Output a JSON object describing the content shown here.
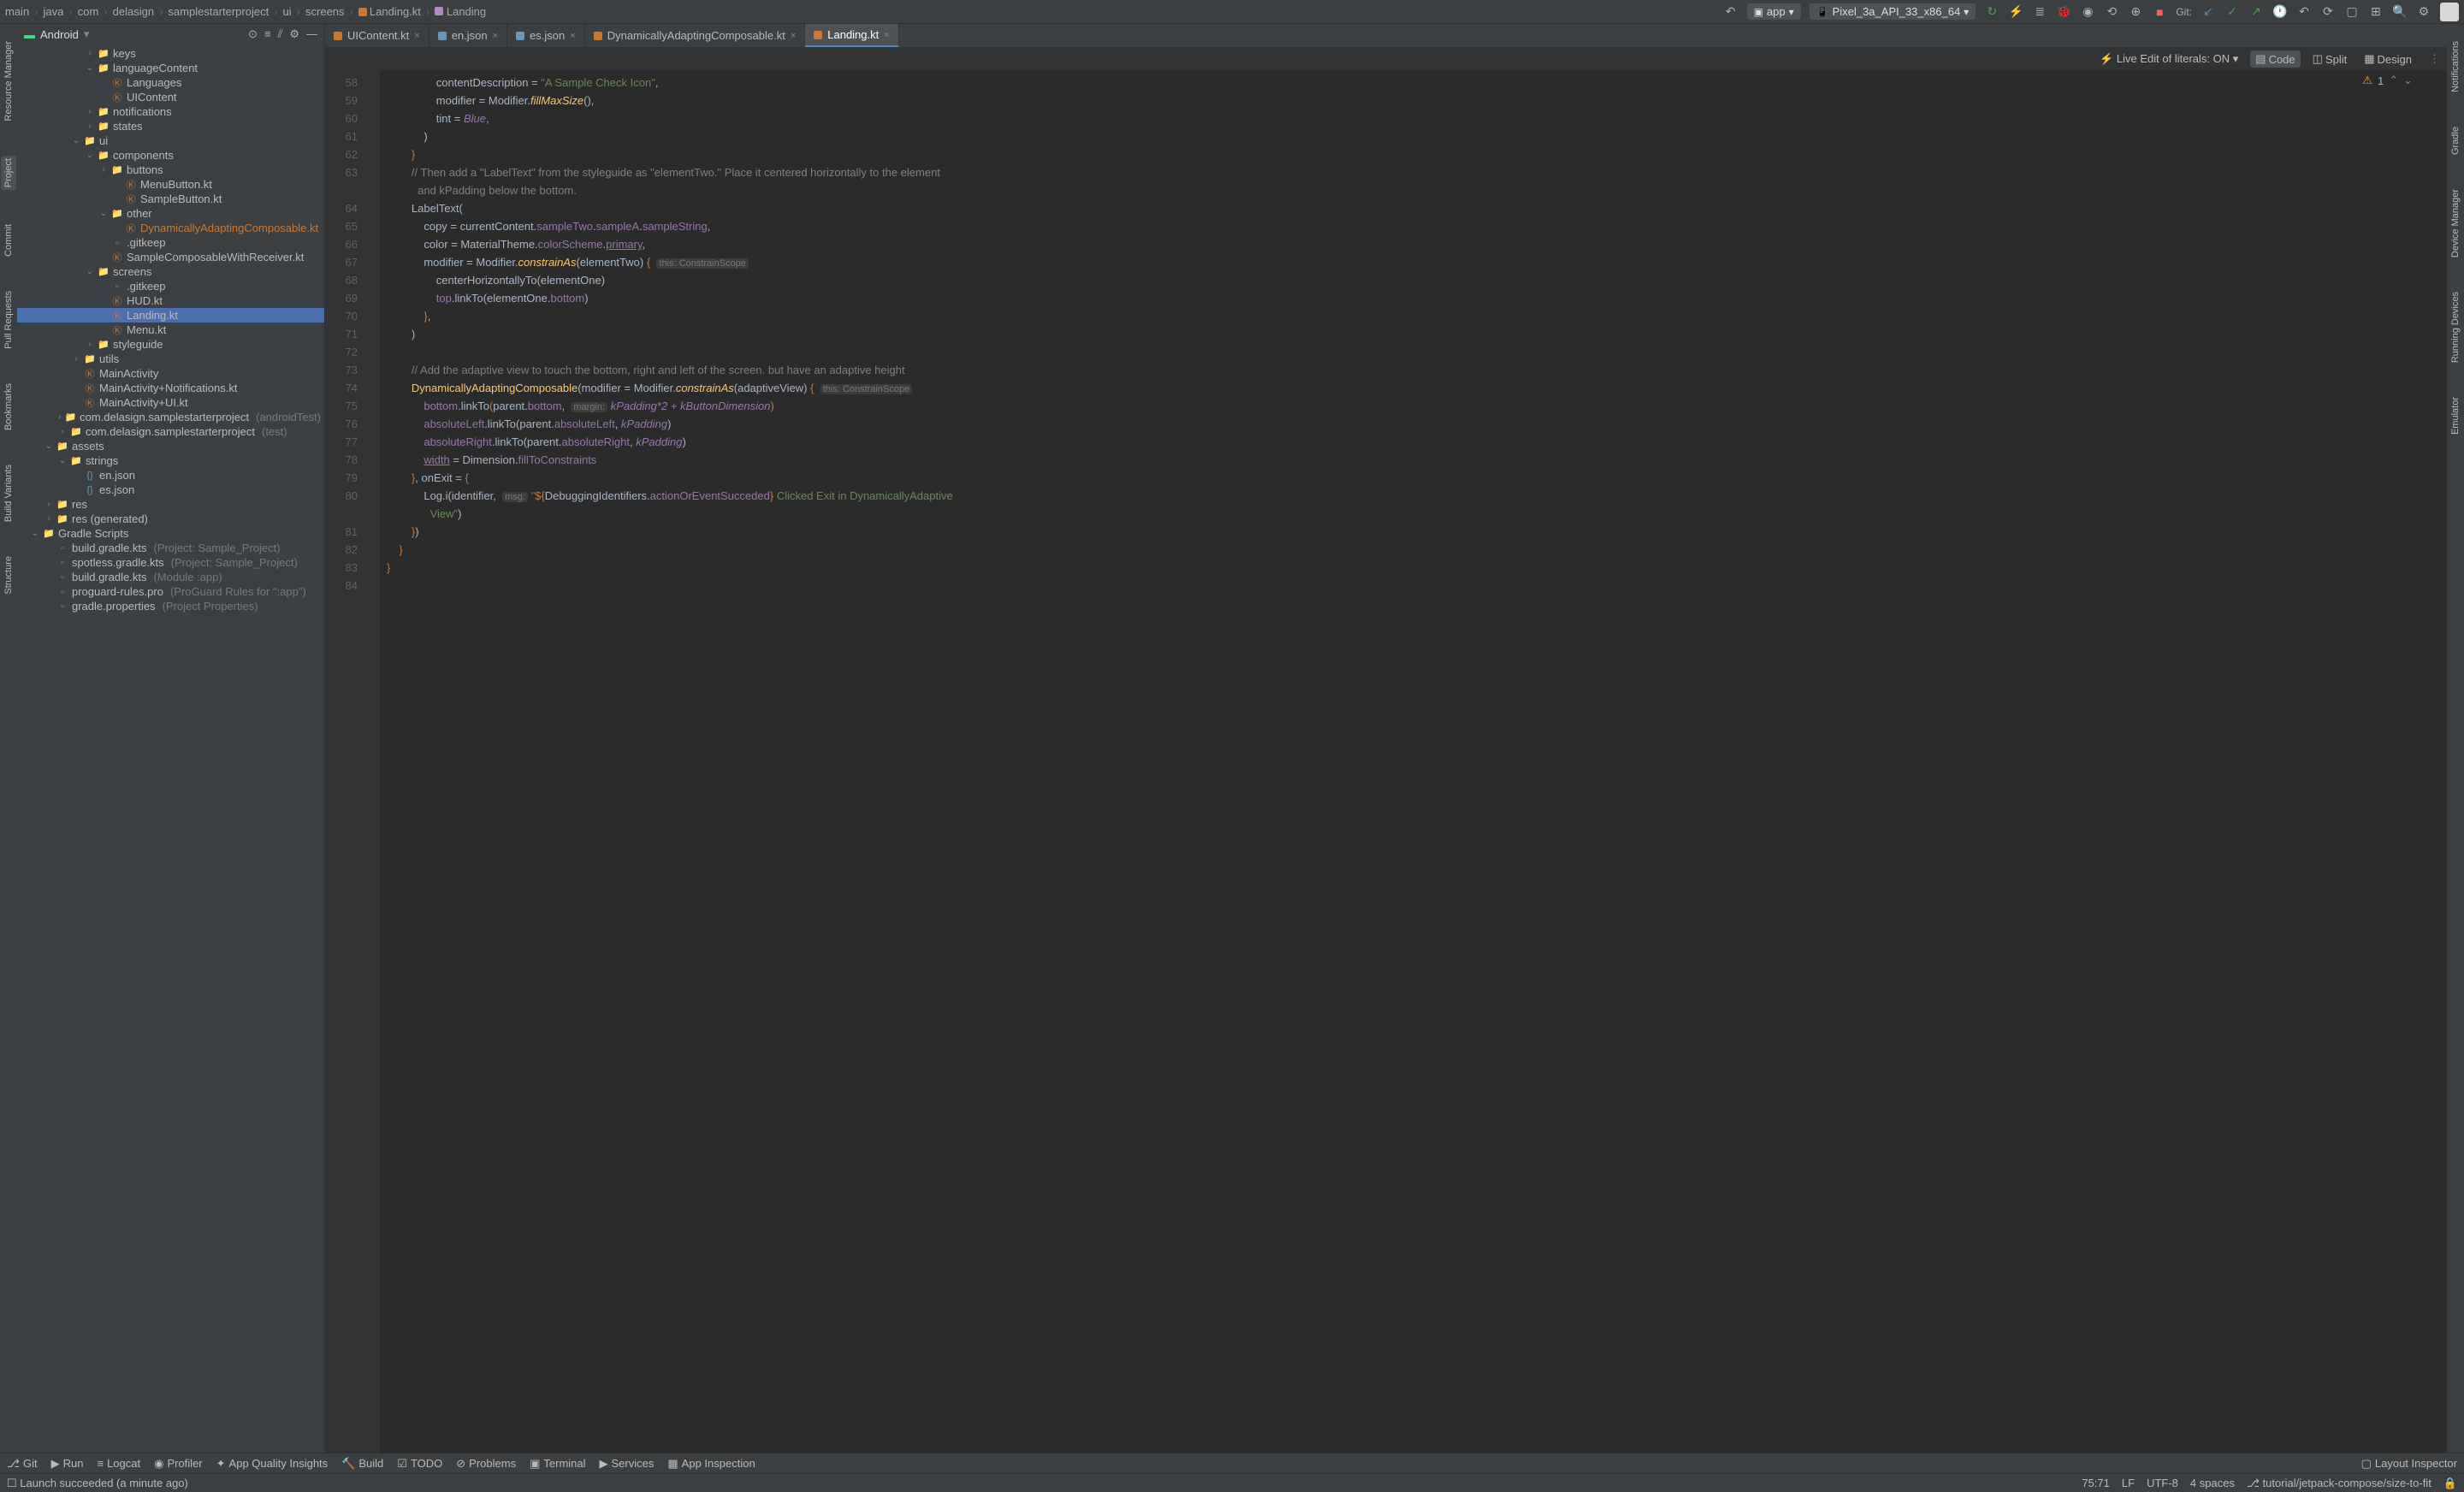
{
  "breadcrumb": [
    "main",
    "java",
    "com",
    "delasign",
    "samplestarterproject",
    "ui",
    "screens"
  ],
  "breadcrumb_file": "Landing.kt",
  "breadcrumb_fn": "Landing",
  "run_config": "app",
  "device": "Pixel_3a_API_33_x86_64",
  "git_label": "Git:",
  "project_header": {
    "title": "Android"
  },
  "tree": [
    {
      "indent": 5,
      "arrow": "›",
      "icon": "folder",
      "label": "keys"
    },
    {
      "indent": 5,
      "arrow": "⌄",
      "icon": "folder",
      "label": "languageContent"
    },
    {
      "indent": 6,
      "arrow": "",
      "icon": "kt",
      "label": "Languages"
    },
    {
      "indent": 6,
      "arrow": "",
      "icon": "kt",
      "label": "UIContent"
    },
    {
      "indent": 5,
      "arrow": "›",
      "icon": "folder",
      "label": "notifications"
    },
    {
      "indent": 5,
      "arrow": "›",
      "icon": "folder",
      "label": "states"
    },
    {
      "indent": 4,
      "arrow": "⌄",
      "icon": "folder",
      "label": "ui"
    },
    {
      "indent": 5,
      "arrow": "⌄",
      "icon": "folder",
      "label": "components"
    },
    {
      "indent": 6,
      "arrow": "›",
      "icon": "folder",
      "label": "buttons"
    },
    {
      "indent": 7,
      "arrow": "",
      "icon": "kt",
      "label": "MenuButton.kt"
    },
    {
      "indent": 7,
      "arrow": "",
      "icon": "kt",
      "label": "SampleButton.kt"
    },
    {
      "indent": 6,
      "arrow": "⌄",
      "icon": "folder",
      "label": "other"
    },
    {
      "indent": 7,
      "arrow": "",
      "icon": "kt",
      "label": "DynamicallyAdaptingComposable.kt",
      "hl": true
    },
    {
      "indent": 6,
      "arrow": "",
      "icon": "other",
      "label": ".gitkeep"
    },
    {
      "indent": 6,
      "arrow": "",
      "icon": "kt",
      "label": "SampleComposableWithReceiver.kt"
    },
    {
      "indent": 5,
      "arrow": "⌄",
      "icon": "folder",
      "label": "screens"
    },
    {
      "indent": 6,
      "arrow": "",
      "icon": "other",
      "label": ".gitkeep"
    },
    {
      "indent": 6,
      "arrow": "",
      "icon": "kt",
      "label": "HUD.kt"
    },
    {
      "indent": 6,
      "arrow": "",
      "icon": "kt",
      "label": "Landing.kt",
      "sel": true
    },
    {
      "indent": 6,
      "arrow": "",
      "icon": "kt",
      "label": "Menu.kt"
    },
    {
      "indent": 5,
      "arrow": "›",
      "icon": "folder",
      "label": "styleguide"
    },
    {
      "indent": 4,
      "arrow": "›",
      "icon": "folder",
      "label": "utils"
    },
    {
      "indent": 4,
      "arrow": "",
      "icon": "kt",
      "label": "MainActivity"
    },
    {
      "indent": 4,
      "arrow": "",
      "icon": "kt",
      "label": "MainActivity+Notifications.kt"
    },
    {
      "indent": 4,
      "arrow": "",
      "icon": "kt",
      "label": "MainActivity+UI.kt"
    },
    {
      "indent": 3,
      "arrow": "›",
      "icon": "folder",
      "label": "com.delasign.samplestarterproject",
      "suffix": "(androidTest)"
    },
    {
      "indent": 3,
      "arrow": "›",
      "icon": "folder",
      "label": "com.delasign.samplestarterproject",
      "suffix": "(test)"
    },
    {
      "indent": 2,
      "arrow": "⌄",
      "icon": "folder",
      "label": "assets"
    },
    {
      "indent": 3,
      "arrow": "⌄",
      "icon": "folder",
      "label": "strings"
    },
    {
      "indent": 4,
      "arrow": "",
      "icon": "json",
      "label": "en.json"
    },
    {
      "indent": 4,
      "arrow": "",
      "icon": "json",
      "label": "es.json"
    },
    {
      "indent": 2,
      "arrow": "›",
      "icon": "folder",
      "label": "res"
    },
    {
      "indent": 2,
      "arrow": "›",
      "icon": "folder",
      "label": "res (generated)"
    },
    {
      "indent": 1,
      "arrow": "⌄",
      "icon": "folder",
      "label": "Gradle Scripts"
    },
    {
      "indent": 2,
      "arrow": "",
      "icon": "other",
      "label": "build.gradle.kts",
      "suffix": "(Project: Sample_Project)"
    },
    {
      "indent": 2,
      "arrow": "",
      "icon": "other",
      "label": "spotless.gradle.kts",
      "suffix": "(Project: Sample_Project)"
    },
    {
      "indent": 2,
      "arrow": "",
      "icon": "other",
      "label": "build.gradle.kts",
      "suffix": "(Module :app)"
    },
    {
      "indent": 2,
      "arrow": "",
      "icon": "other",
      "label": "proguard-rules.pro",
      "suffix": "(ProGuard Rules for \":app\")"
    },
    {
      "indent": 2,
      "arrow": "",
      "icon": "other",
      "label": "gradle.properties",
      "suffix": "(Project Properties)"
    }
  ],
  "editor_tabs": [
    {
      "label": "UIContent.kt",
      "icon": "kt"
    },
    {
      "label": "en.json",
      "icon": "json"
    },
    {
      "label": "es.json",
      "icon": "json"
    },
    {
      "label": "DynamicallyAdaptingComposable.kt",
      "icon": "kt"
    },
    {
      "label": "Landing.kt",
      "icon": "kt",
      "active": true
    }
  ],
  "live_edit": "Live Edit of literals: ON",
  "view_modes": {
    "code": "Code",
    "split": "Split",
    "design": "Design"
  },
  "warn_count": "1",
  "line_numbers": [
    58,
    59,
    60,
    61,
    62,
    63,
    64,
    65,
    66,
    67,
    68,
    69,
    70,
    71,
    72,
    73,
    74,
    75,
    76,
    77,
    78,
    79,
    80,
    81,
    82,
    83,
    84
  ],
  "code": {
    "l58": "                contentDescription = \"A Sample Check Icon\",",
    "l59": "                modifier = Modifier.fillMaxSize(),",
    "l60": "                tint = Blue,",
    "l61": "            )",
    "l62": "        }",
    "l63a": "        // Then add a \"LabelText\" from the styleguide as \"elementTwo.\" Place it centered horizontally to the element",
    "l63b": "          and kPadding below the bottom.",
    "l64": "        LabelText(",
    "l65": "            copy = currentContent.sampleTwo.sampleA.sampleString,",
    "l66": "            color = MaterialTheme.colorScheme.primary,",
    "l67": "            modifier = Modifier.constrainAs(elementTwo) {",
    "l67h": "this: ConstrainScope",
    "l68": "                centerHorizontallyTo(elementOne)",
    "l69": "                top.linkTo(elementOne.bottom)",
    "l70": "            },",
    "l71": "        )",
    "l72": "",
    "l73": "        // Add the adaptive view to touch the bottom, right and left of the screen. but have an adaptive height",
    "l74": "        DynamicallyAdaptingComposable(modifier = Modifier.constrainAs(adaptiveView) {",
    "l74h": "this: ConstrainScope",
    "l75": "            bottom.linkTo(parent.bottom,",
    "l75h": "margin:",
    "l75b": " kPadding*2 + kButtonDimension)",
    "l76": "            absoluteLeft.linkTo(parent.absoluteLeft, kPadding)",
    "l77": "            absoluteRight.linkTo(parent.absoluteRight, kPadding)",
    "l78": "            width = Dimension.fillToConstraints",
    "l79": "        }, onExit = {",
    "l80": "            Log.i(identifier,",
    "l80h": "msg:",
    "l80b": " \"${DebuggingIdentifiers.actionOrEventSucceded} Clicked Exit in DynamicallyAdaptive",
    "l80c": "              View\")",
    "l81": "        })",
    "l82": "    }",
    "l83": "}",
    "l84": ""
  },
  "left_tools": [
    "Resource Manager",
    "Project",
    "Commit",
    "Pull Requests",
    "Bookmarks",
    "Structure",
    "Build Variants"
  ],
  "right_tools": [
    "Notifications",
    "Gradle",
    "Device Manager",
    "Running Devices",
    "Emulator"
  ],
  "bottom_tabs": [
    "Git",
    "Run",
    "Logcat",
    "Profiler",
    "App Quality Insights",
    "Build",
    "TODO",
    "Problems",
    "Terminal",
    "Services",
    "App Inspection"
  ],
  "bottom_right": "Layout Inspector",
  "status": {
    "msg": "Launch succeeded (a minute ago)",
    "pos": "75:71",
    "le": "LF",
    "enc": "UTF-8",
    "indent": "4 spaces",
    "branch": "tutorial/jetpack-compose/size-to-fit"
  }
}
